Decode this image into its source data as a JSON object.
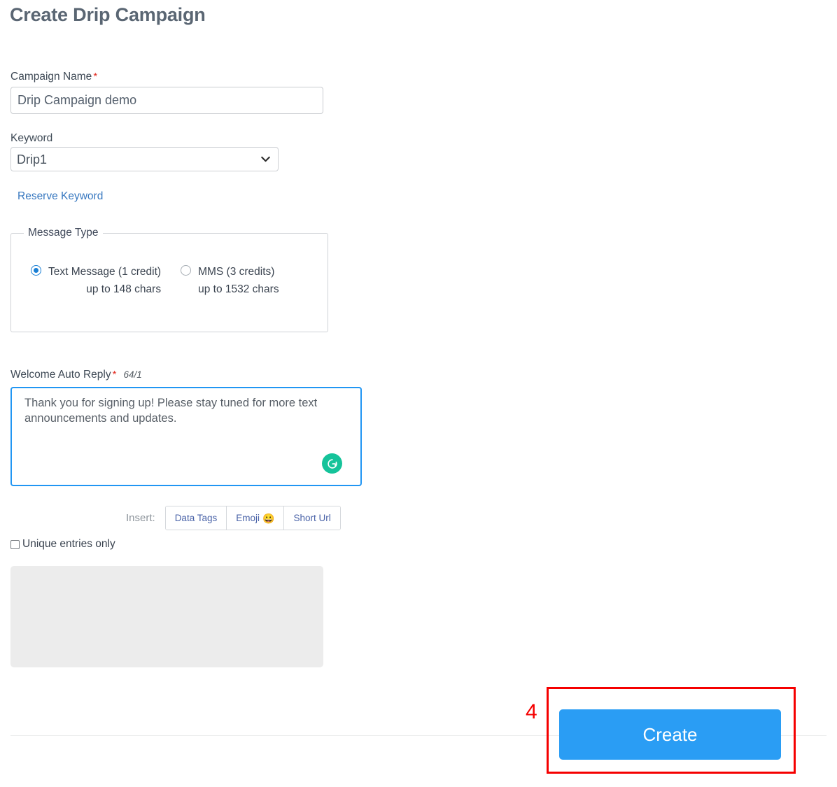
{
  "page": {
    "title": "Create Drip Campaign"
  },
  "campaign_name": {
    "label": "Campaign Name",
    "required_marker": "*",
    "value": "Drip Campaign demo",
    "placeholder": ""
  },
  "keyword": {
    "label": "Keyword",
    "selected": "Drip1",
    "options": [
      "Drip1"
    ],
    "caret_icon": "chevron-down-icon",
    "reserve_link": "Reserve Keyword"
  },
  "message_type": {
    "legend": "Message Type",
    "options": [
      {
        "label": "Text Message (1 credit)",
        "sub": "up to 148 chars",
        "selected": true
      },
      {
        "label": "MMS (3 credits)",
        "sub": "up to 1532 chars",
        "selected": false
      }
    ]
  },
  "welcome_reply": {
    "label": "Welcome Auto Reply",
    "required_marker": "*",
    "counter": "64/1",
    "value": "Thank you for signing up! Please stay tuned for more text announcements and updates.",
    "placeholder": "",
    "assistant_icon": "grammarly-icon"
  },
  "insert_toolbar": {
    "label": "Insert:",
    "buttons": [
      {
        "label": "Data Tags",
        "icon": ""
      },
      {
        "label": "Emoji",
        "icon": "😀"
      },
      {
        "label": "Short Url",
        "icon": ""
      }
    ]
  },
  "unique_entries": {
    "label": "Unique entries only",
    "checked": false
  },
  "footer": {
    "create_label": "Create"
  },
  "annotation": {
    "step_number": "4",
    "highlight_color": "#f50000"
  },
  "colors": {
    "accent_blue": "#2a9df4",
    "link_blue": "#3878c0",
    "focus_blue": "#2196f3",
    "required_red": "#e33228",
    "annotation_red": "#f50000",
    "grammarly_green": "#15c39a",
    "panel_gray": "#ececec",
    "title_gray": "#5a6673"
  }
}
